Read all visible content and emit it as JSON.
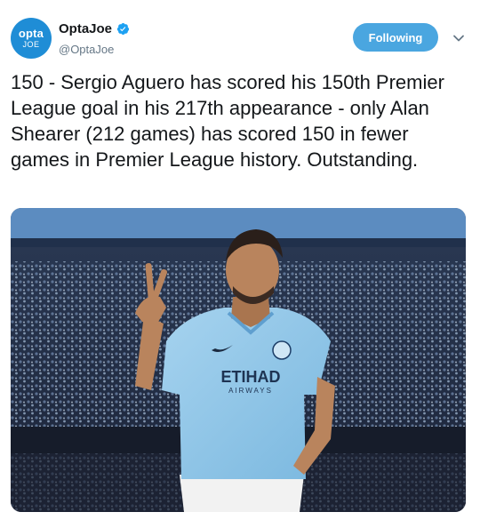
{
  "account": {
    "avatar_line1": "opta",
    "avatar_line2": "JOE",
    "display_name": "OptaJoe",
    "handle": "@OptaJoe",
    "verified": true
  },
  "actions": {
    "follow_label": "Following"
  },
  "tweet": {
    "text": "150 - Sergio Aguero has scored his 150th Premier League goal in his 217th appearance - only Alan Shearer (212 games) has scored 150 in fewer games in Premier League history. Outstanding."
  },
  "photo": {
    "shirt_sponsor_line1": "ETIHAD",
    "shirt_sponsor_line2": "AIRWAYS"
  },
  "colors": {
    "brand_blue": "#1f8dd6",
    "follow_button": "#4aa6e0",
    "shirt_sky_blue": "#8fc6e8"
  },
  "icons": {
    "verified": "verified-badge-icon",
    "more": "chevron-down-icon"
  }
}
